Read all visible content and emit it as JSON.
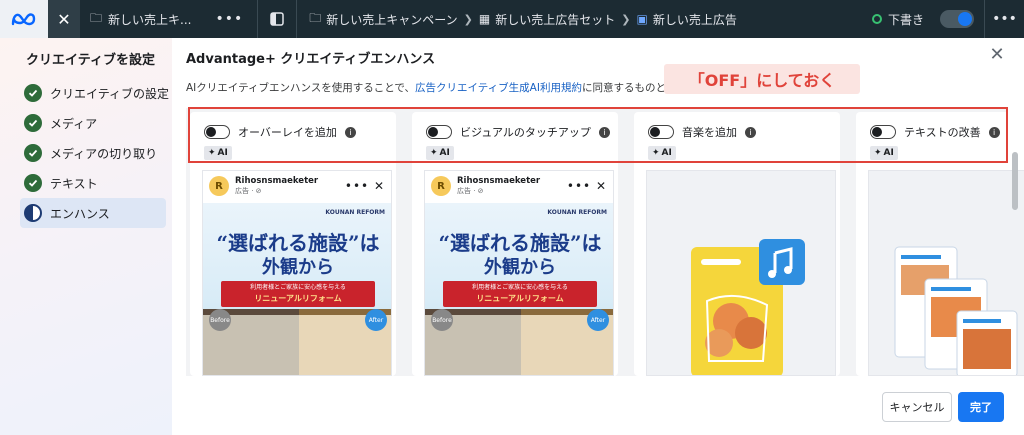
{
  "topbar": {
    "tab_label": "新しい売上キ...",
    "more": "•••",
    "breadcrumbs": [
      "新しい売上キャンペーン",
      "新しい売上広告セット",
      "新しい売上広告"
    ],
    "draft_label": "下書き",
    "dots": "•••"
  },
  "sidebar": {
    "title": "クリエイティブを設定",
    "steps": [
      {
        "label": "クリエイティブの設定",
        "status": "done"
      },
      {
        "label": "メディア",
        "status": "done"
      },
      {
        "label": "メディアの切り取り",
        "status": "done"
      },
      {
        "label": "テキスト",
        "status": "done"
      },
      {
        "label": "エンハンス",
        "status": "current"
      }
    ]
  },
  "main": {
    "title": "Advantage+ クリエイティブエンハンス",
    "desc_prefix": "AIクリエイティブエンハンスを使用することで、",
    "desc_link": "広告クリエイティブ生成AI利用規約",
    "desc_suffix": "に同意するものとします。",
    "callout": "「OFF」にしておく",
    "ai_badge": "AI",
    "cards": [
      {
        "label": "オーバーレイを追加",
        "enabled": false
      },
      {
        "label": "ビジュアルのタッチアップ",
        "enabled": false
      },
      {
        "label": "音楽を追加",
        "enabled": false
      },
      {
        "label": "テキストの改善",
        "enabled": false
      }
    ],
    "preview": {
      "account": "Rihosnsmaeketer",
      "sub": "広告 · ⊘",
      "avatar": "R",
      "brand": "KOUNAN REFORM",
      "headline1": "“選ばれる施設”は",
      "headline2": "外観から",
      "ribbon1": "利用者様とご家族に安心感を与える",
      "ribbon2": "リニューアルリフォーム",
      "before": "Before",
      "after": "After"
    },
    "cancel_label": "キャンセル",
    "done_label": "完了"
  },
  "colors": {
    "topbar": "#1c2b33",
    "accent": "#1877f2",
    "callout_text": "#e0433a",
    "callout_bg": "#fbe4e1",
    "check": "#2e6b3a"
  }
}
